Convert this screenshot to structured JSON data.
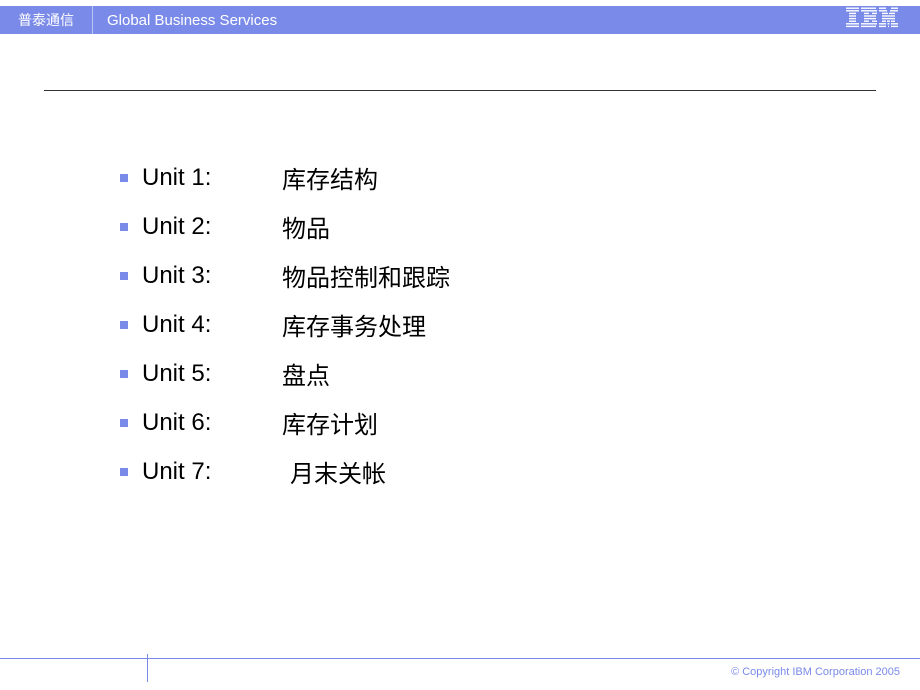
{
  "header": {
    "client": "普泰通信",
    "division": "Global Business Services",
    "logo": "IBM"
  },
  "units": [
    {
      "label": "Unit 1:",
      "desc": "库存结构",
      "indent": false
    },
    {
      "label": "Unit 2:",
      "desc": "物品",
      "indent": false
    },
    {
      "label": "Unit 3:",
      "desc": "物品控制和跟踪",
      "indent": false
    },
    {
      "label": "Unit 4:",
      "desc": "库存事务处理",
      "indent": false
    },
    {
      "label": "Unit 5:",
      "desc": "盘点",
      "indent": false
    },
    {
      "label": "Unit 6:",
      "desc": "库存计划",
      "indent": false
    },
    {
      "label": "Unit 7:",
      "desc": "月末关帐",
      "indent": true
    }
  ],
  "footer": {
    "copyright": "© Copyright IBM Corporation 2005"
  }
}
